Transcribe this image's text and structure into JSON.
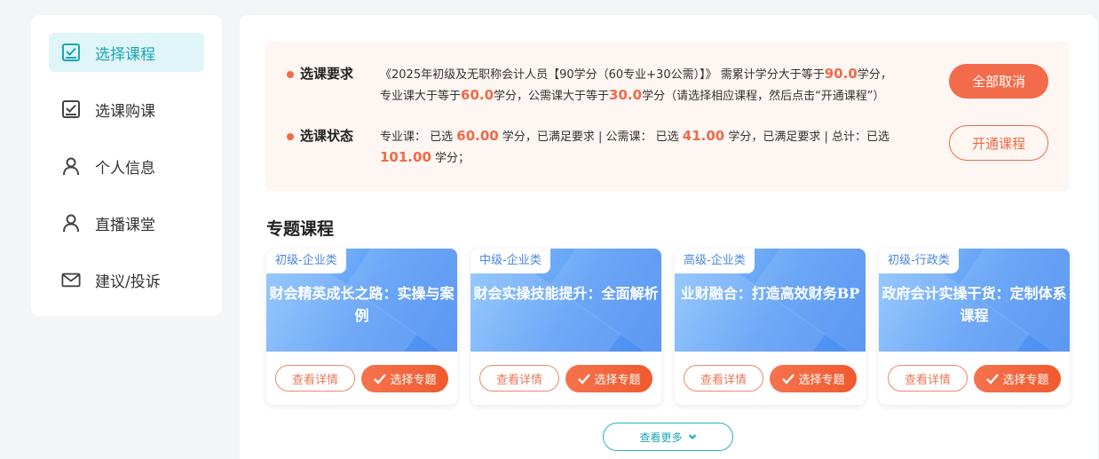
{
  "sidebar": {
    "items": [
      {
        "label": "选择课程",
        "icon": "checkbox-icon",
        "active": true
      },
      {
        "label": "选课购课",
        "icon": "checkbox-icon",
        "active": false
      },
      {
        "label": "个人信息",
        "icon": "user-icon",
        "active": false
      },
      {
        "label": "直播课堂",
        "icon": "user-icon",
        "active": false
      },
      {
        "label": "建议/投诉",
        "icon": "mail-icon",
        "active": false
      }
    ]
  },
  "requirements": {
    "req_title": "选课要求",
    "req_line1_a": "《2025年初级及无职称会计人员【90学分（60专业+30公需）】》 需累计学分大于等于",
    "req_total": "90.0",
    "req_line1_b": "学分，",
    "req_line2_a": "专业课大于等于",
    "req_prof": "60.0",
    "req_line2_b": "学分，公需课大于等于",
    "req_public": "30.0",
    "req_line2_c": "学分（请选择相应课程，然后点击“开通课程”）",
    "status_title": "选课状态",
    "status_a": "专业课： 已选 ",
    "status_prof": "60.00",
    "status_b": " 学分，已满足要求 | 公需课： 已选 ",
    "status_public": "41.00",
    "status_c": " 学分，已满足要求 | 总计：已选",
    "status_total": "101.00",
    "status_d": " 学分；",
    "cancel_all": "全部取消",
    "open_course": "开通课程"
  },
  "section_title": "专题课程",
  "cards": [
    {
      "tag": "初级-企业类",
      "title": "财会精英成长之路：实操与案例",
      "detail": "查看详情",
      "select": "选择专题"
    },
    {
      "tag": "中级-企业类",
      "title": "财会实操技能提升：全面解析",
      "detail": "查看详情",
      "select": "选择专题"
    },
    {
      "tag": "高级-企业类",
      "title": "业财融合：打造高效财务BP",
      "detail": "查看详情",
      "select": "选择专题"
    },
    {
      "tag": "初级-行政类",
      "title": "政府会计实操干货：定制体系课程",
      "detail": "查看详情",
      "select": "选择专题"
    }
  ],
  "more_label": "查看更多",
  "colors": {
    "accent": "#f06a46",
    "teal": "#19a6b3",
    "card_blue": "#5b9cf5"
  }
}
